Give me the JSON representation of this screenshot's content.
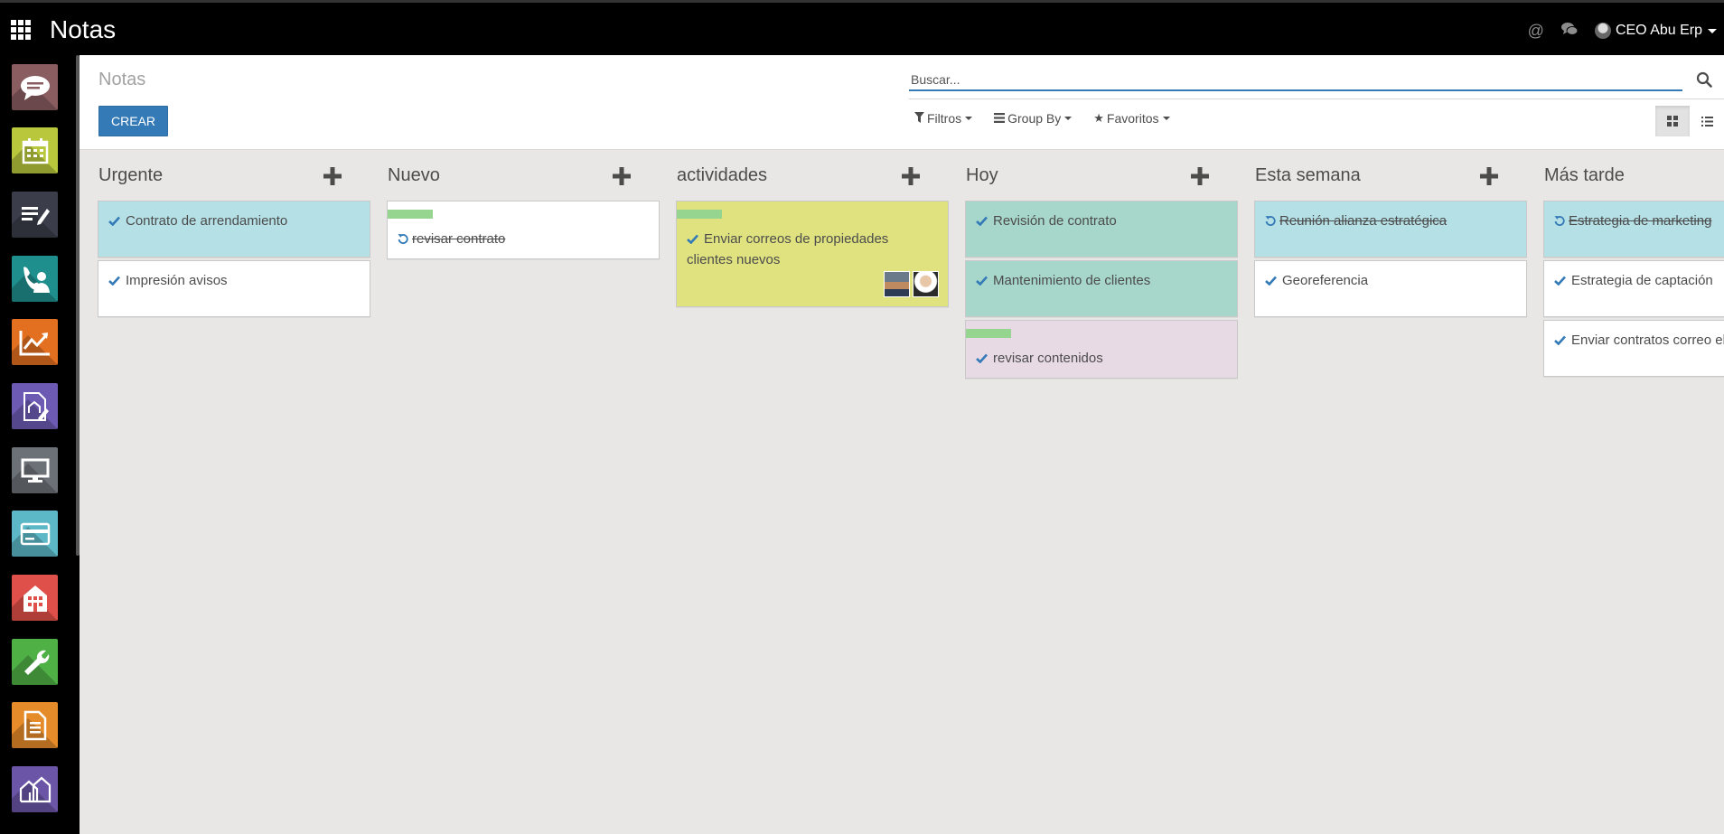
{
  "topbar": {
    "app_title": "Notas",
    "user_name": "CEO Abu Erp",
    "icons": [
      "apps-icon",
      "mention-icon",
      "chat-icon"
    ]
  },
  "sidebar": {
    "apps": [
      {
        "name": "discuss",
        "color": "#8a5d61"
      },
      {
        "name": "calendar",
        "color": "#b8c73c"
      },
      {
        "name": "notes",
        "color": "#3b3e4a"
      },
      {
        "name": "contacts",
        "color": "#1f8f8d"
      },
      {
        "name": "crm",
        "color": "#e36f21"
      },
      {
        "name": "real-estate-docs",
        "color": "#6d5bb3"
      },
      {
        "name": "website",
        "color": "#6c7177"
      },
      {
        "name": "payments",
        "color": "#5cb8c6"
      },
      {
        "name": "buildings",
        "color": "#e0504a"
      },
      {
        "name": "settings-tools",
        "color": "#4fb046"
      },
      {
        "name": "documents",
        "color": "#e68b2a"
      },
      {
        "name": "properties",
        "color": "#6a55a6"
      }
    ]
  },
  "control": {
    "breadcrumb": "Notas",
    "create_label": "CREAR",
    "search_placeholder": "Buscar...",
    "filters_label": "Filtros",
    "groupby_label": "Group By",
    "favorites_label": "Favoritos"
  },
  "kanban": {
    "columns": [
      {
        "title": "Urgente",
        "show_add": true,
        "cards": [
          {
            "text": "Contrato de arrendamiento",
            "color": "blue",
            "state": "done",
            "tag": false
          },
          {
            "text": "Impresión avisos",
            "color": "white",
            "state": "done",
            "tag": false
          }
        ]
      },
      {
        "title": "Nuevo",
        "show_add": true,
        "cards": [
          {
            "text": "revisar contrato",
            "color": "white",
            "state": "archived",
            "tag": true
          }
        ]
      },
      {
        "title": "actividades",
        "show_add": true,
        "cards": [
          {
            "text": "Enviar correos de propiedades clientes nuevos",
            "color": "yellow",
            "state": "done",
            "tag": true,
            "avatars": 2
          }
        ]
      },
      {
        "title": "Hoy",
        "show_add": true,
        "cards": [
          {
            "text": "Revisión de contrato",
            "color": "green",
            "state": "done",
            "tag": false
          },
          {
            "text": "Mantenimiento de clientes",
            "color": "green",
            "state": "done",
            "tag": false
          },
          {
            "text": "revisar contenidos",
            "color": "pink",
            "state": "done",
            "tag": true
          }
        ]
      },
      {
        "title": "Esta semana",
        "show_add": true,
        "cards": [
          {
            "text": "Reunión alianza estratégica",
            "color": "blue",
            "state": "archived",
            "tag": false
          },
          {
            "text": "Georeferencia",
            "color": "white",
            "state": "done",
            "tag": false
          }
        ]
      },
      {
        "title": "Más tarde",
        "show_add": false,
        "cards": [
          {
            "text": "Estrategia de marketing",
            "color": "blue",
            "state": "archived",
            "tag": false
          },
          {
            "text": "Estrategia de captación",
            "color": "white",
            "state": "done",
            "tag": false
          },
          {
            "text": "Enviar contratos correo electrónico",
            "color": "white",
            "state": "done",
            "tag": false
          }
        ]
      }
    ]
  }
}
